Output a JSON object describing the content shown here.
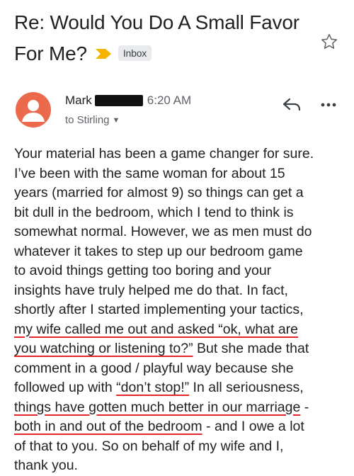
{
  "email": {
    "subject_line1": "Re: Would You Do A Small Favor",
    "subject_line2": "For Me?",
    "label": "Inbox",
    "sender_name": "Mark",
    "time": "6:20 AM",
    "recipient": "to Stirling",
    "body_lines": [
      "Your material has been a game changer for sure.",
      "I’ve been with the same woman for about 15",
      "years (married for almost 9) so things can get a",
      "bit dull in the bedroom, which I tend to think is",
      "somewhat normal. However, we as men must do",
      "whatever it takes to step up our bedroom game",
      "to avoid things getting too boring and your",
      "insights have truly helped me do that. In fact,",
      "shortly after I started implementing your tactics,"
    ],
    "line10_ul": "my wife called me out and asked “ok, what are",
    "line11_ul": "you watching or listening to?”",
    "line11_rest": " But she made that",
    "line12": "comment in a good / playful way because she",
    "line13_pre": "followed up with ",
    "line13_ul": "“don’t stop!”",
    "line13_rest": " In all seriousness,",
    "line14_ul": "things have gotten much better in our marriage",
    "line14_rest": " -",
    "line15_ul": "both in and out of the bedroom",
    "line15_rest": " - and I owe a lot",
    "line16": "of that to you. So on behalf of my wife and I,",
    "line17": "thank you."
  },
  "colors": {
    "avatar": "#ec6a4c",
    "importance_marker": "#f4b400",
    "underline": "#e3262c"
  },
  "icons": {
    "importance": "importance-marker-icon",
    "star": "star-icon",
    "reply": "reply-icon",
    "more": "more-options-icon",
    "avatar": "person-icon",
    "recipient_details": "chevron-down-icon"
  }
}
